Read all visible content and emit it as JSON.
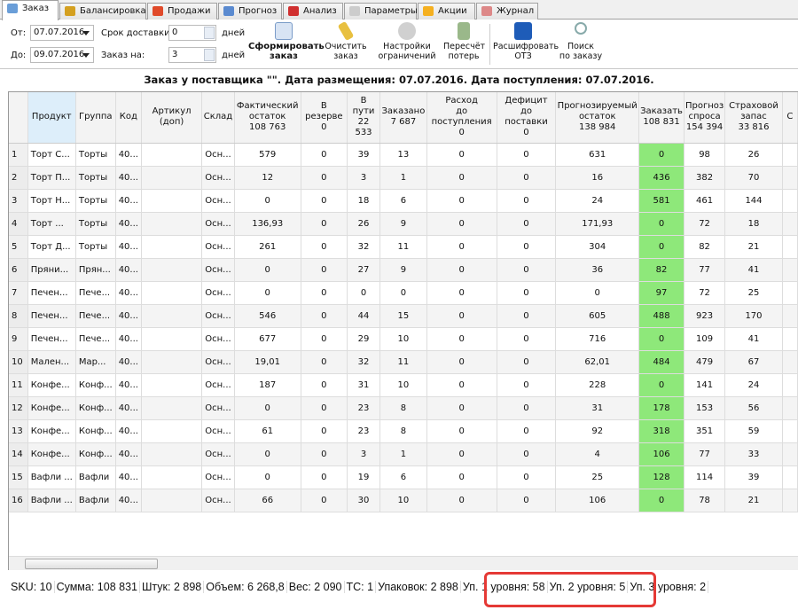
{
  "tabs": [
    {
      "label": "Заказ",
      "icon": "order-icon",
      "color": "#6a9ed8",
      "active": true
    },
    {
      "label": "Балансировка",
      "icon": "scales-icon",
      "color": "#d4a020"
    },
    {
      "label": "Продажи",
      "icon": "sales-icon",
      "color": "#e04a2a"
    },
    {
      "label": "Прогноз",
      "icon": "chart-icon",
      "color": "#5a8ad0"
    },
    {
      "label": "Анализ",
      "icon": "pie-icon",
      "color": "#d03030"
    },
    {
      "label": "Параметры",
      "icon": "gear-icon",
      "color": "#cccccc"
    },
    {
      "label": "Акции",
      "icon": "star-icon",
      "color": "#f5b020"
    },
    {
      "label": "Журнал",
      "icon": "journal-icon",
      "color": "#d88"
    }
  ],
  "filters": {
    "from_label": "От:",
    "from_value": "07.07.2016",
    "to_label": "До:",
    "to_value": "09.07.2016",
    "delivery_label": "Срок доставки:",
    "delivery_value": "0",
    "order_for_label": "Заказ на:",
    "order_for_value": "3",
    "days": "дней"
  },
  "toolbar": {
    "form": "Сформировать\nзаказ",
    "clear": "Очистить\nзаказ",
    "limits": "Настройки\nограничений",
    "recalc": "Пересчёт\nпотерь",
    "decode": "Расшифровать\nОТЗ",
    "search": "Поиск\nпо заказу"
  },
  "title": "Заказ у поставщика \"\". Дата размещения: 07.07.2016. Дата поступления: 07.07.2016.",
  "columns": [
    "",
    "Продукт",
    "Группа",
    "Код",
    "Артикул (доп)",
    "Склад",
    "Фактический\nостаток\n108 763",
    "В резерве\n0",
    "В пути\n22 533",
    "Заказано\n7 687",
    "Расход\nдо поступления\n0",
    "Дефицит\nдо поставки\n0",
    "Прогнозируемый\nостаток\n138 984",
    "Заказать\n108 831",
    "Прогноз\nспроса\n154 394",
    "Страховой\nзапас\n33 816",
    "С"
  ],
  "rows": [
    [
      "1",
      "Торт С...",
      "Торты",
      "40...",
      "",
      "Осн...",
      "579",
      "0",
      "39",
      "13",
      "0",
      "0",
      "631",
      "0",
      "98",
      "26",
      ""
    ],
    [
      "2",
      "Торт П...",
      "Торты",
      "40...",
      "",
      "Осн...",
      "12",
      "0",
      "3",
      "1",
      "0",
      "0",
      "16",
      "436",
      "382",
      "70",
      ""
    ],
    [
      "3",
      "Торт Н...",
      "Торты",
      "40...",
      "",
      "Осн...",
      "0",
      "0",
      "18",
      "6",
      "0",
      "0",
      "24",
      "581",
      "461",
      "144",
      ""
    ],
    [
      "4",
      "Торт ...",
      "Торты",
      "40...",
      "",
      "Осн...",
      "136,93",
      "0",
      "26",
      "9",
      "0",
      "0",
      "171,93",
      "0",
      "72",
      "18",
      ""
    ],
    [
      "5",
      "Торт Д...",
      "Торты",
      "40...",
      "",
      "Осн...",
      "261",
      "0",
      "32",
      "11",
      "0",
      "0",
      "304",
      "0",
      "82",
      "21",
      ""
    ],
    [
      "6",
      "Пряни...",
      "Прян...",
      "40...",
      "",
      "Осн...",
      "0",
      "0",
      "27",
      "9",
      "0",
      "0",
      "36",
      "82",
      "77",
      "41",
      ""
    ],
    [
      "7",
      "Печен...",
      "Пече...",
      "40...",
      "",
      "Осн...",
      "0",
      "0",
      "0",
      "0",
      "0",
      "0",
      "0",
      "97",
      "72",
      "25",
      ""
    ],
    [
      "8",
      "Печен...",
      "Пече...",
      "40...",
      "",
      "Осн...",
      "546",
      "0",
      "44",
      "15",
      "0",
      "0",
      "605",
      "488",
      "923",
      "170",
      ""
    ],
    [
      "9",
      "Печен...",
      "Пече...",
      "40...",
      "",
      "Осн...",
      "677",
      "0",
      "29",
      "10",
      "0",
      "0",
      "716",
      "0",
      "109",
      "41",
      ""
    ],
    [
      "10",
      "Мален...",
      "Мар...",
      "40...",
      "",
      "Осн...",
      "19,01",
      "0",
      "32",
      "11",
      "0",
      "0",
      "62,01",
      "484",
      "479",
      "67",
      ""
    ],
    [
      "11",
      "Конфе...",
      "Конф...",
      "40...",
      "",
      "Осн...",
      "187",
      "0",
      "31",
      "10",
      "0",
      "0",
      "228",
      "0",
      "141",
      "24",
      ""
    ],
    [
      "12",
      "Конфе...",
      "Конф...",
      "40...",
      "",
      "Осн...",
      "0",
      "0",
      "23",
      "8",
      "0",
      "0",
      "31",
      "178",
      "153",
      "56",
      ""
    ],
    [
      "13",
      "Конфе...",
      "Конф...",
      "40...",
      "",
      "Осн...",
      "61",
      "0",
      "23",
      "8",
      "0",
      "0",
      "92",
      "318",
      "351",
      "59",
      ""
    ],
    [
      "14",
      "Конфе...",
      "Конф...",
      "40...",
      "",
      "Осн...",
      "0",
      "0",
      "3",
      "1",
      "0",
      "0",
      "4",
      "106",
      "77",
      "33",
      ""
    ],
    [
      "15",
      "Вафли ...",
      "Вафли",
      "40...",
      "",
      "Осн...",
      "0",
      "0",
      "19",
      "6",
      "0",
      "0",
      "25",
      "128",
      "114",
      "39",
      ""
    ],
    [
      "16",
      "Вафли ...",
      "Вафли",
      "40...",
      "",
      "Осн...",
      "66",
      "0",
      "30",
      "10",
      "0",
      "0",
      "106",
      "0",
      "78",
      "21",
      ""
    ]
  ],
  "highlight_color": "#8ee87a",
  "status": [
    "SKU: 10",
    "Сумма: 108 831",
    "Штук: 2 898",
    "Объем: 6 268,8",
    "Вес: 2 090",
    "ТС: 1",
    "Упаковок: 2 898",
    "Уп. 1 уровня: 58",
    "Уп. 2 уровня: 5",
    "Уп. 3 уровня: 2"
  ]
}
